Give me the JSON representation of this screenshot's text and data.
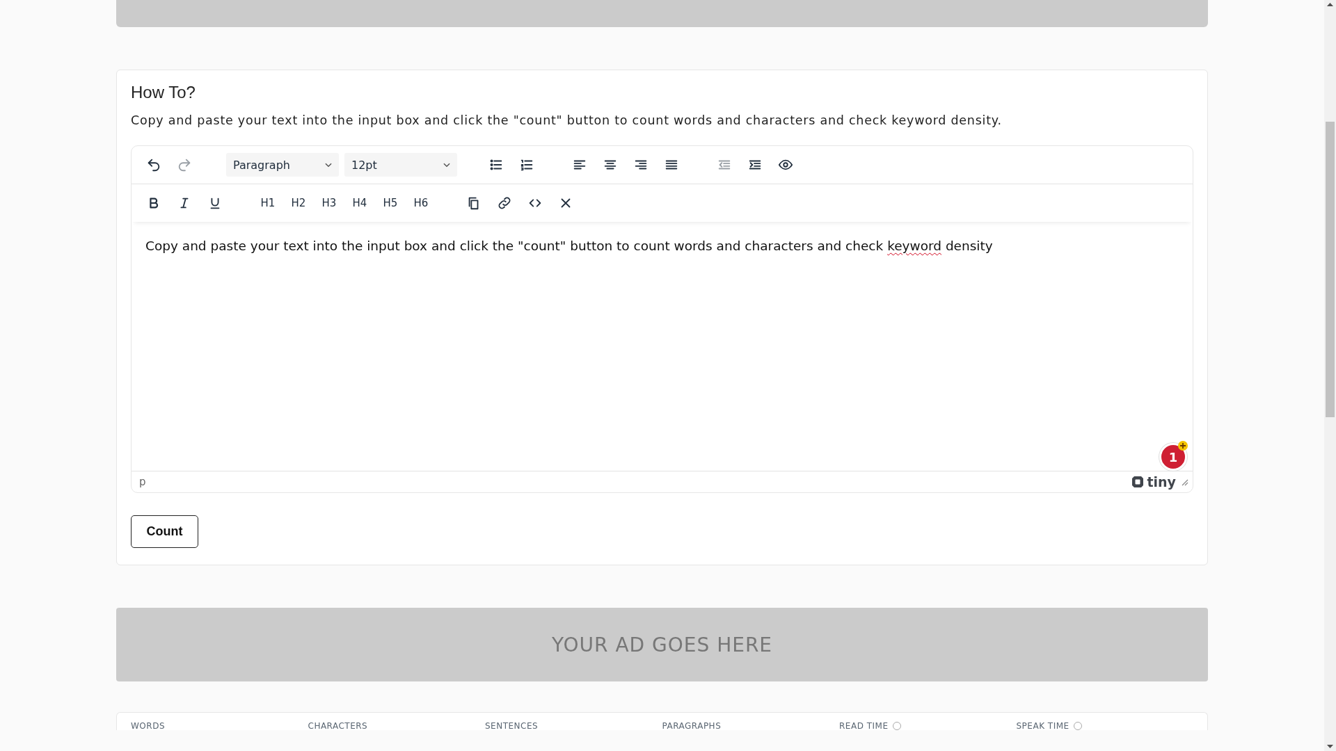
{
  "how_to": {
    "title": "How To?",
    "description": "Copy and paste your text into the input box and click the \"count\" button to count words and characters and check keyword density."
  },
  "editor": {
    "toolbar_rows": [
      [
        {
          "kind": "icon",
          "disabled": false
        },
        {
          "kind": "icon",
          "disabled": true
        },
        {
          "kind": "select",
          "label": "Paragraph"
        },
        {
          "kind": "select",
          "label": "12pt"
        },
        {
          "kind": "icon",
          "disabled": false
        },
        {
          "kind": "icon",
          "disabled": false
        },
        {
          "kind": "icon",
          "disabled": false
        },
        {
          "kind": "icon",
          "disabled": false
        },
        {
          "kind": "icon",
          "disabled": false
        },
        {
          "kind": "icon",
          "disabled": false
        },
        {
          "kind": "icon",
          "disabled": true
        },
        {
          "kind": "icon",
          "disabled": false
        },
        {
          "kind": "icon",
          "disabled": false
        }
      ],
      [
        {
          "kind": "icon",
          "disabled": false
        },
        {
          "kind": "icon",
          "disabled": false
        },
        {
          "kind": "icon",
          "disabled": false
        },
        {
          "kind": "text",
          "label": "H1"
        },
        {
          "kind": "text",
          "label": "H2"
        },
        {
          "kind": "text",
          "label": "H3"
        },
        {
          "kind": "text",
          "label": "H4"
        },
        {
          "kind": "text",
          "label": "H5"
        },
        {
          "kind": "text",
          "label": "H6"
        },
        {
          "kind": "icon",
          "disabled": false
        },
        {
          "kind": "icon",
          "disabled": false
        },
        {
          "kind": "icon",
          "disabled": false
        },
        {
          "kind": "icon",
          "disabled": false
        }
      ]
    ],
    "content": [
      {
        "text": "Copy and paste your text into the input box and click the \"count\" button to count words and characters and check ",
        "misspelled": false
      },
      {
        "text": "keyword",
        "misspelled": true
      },
      {
        "text": " density",
        "misspelled": false
      }
    ],
    "badge": "1",
    "status_path": "p",
    "brand": "tiny"
  },
  "count_button": "Count",
  "ad": "YOUR AD GOES HERE",
  "stats": [
    {
      "label": "WORDS",
      "info": false
    },
    {
      "label": "CHARACTERS",
      "info": false
    },
    {
      "label": "SENTENCES",
      "info": false
    },
    {
      "label": "PARAGRAPHS",
      "info": false
    },
    {
      "label": "READ TIME",
      "info": true
    },
    {
      "label": "SPEAK TIME",
      "info": true
    }
  ]
}
